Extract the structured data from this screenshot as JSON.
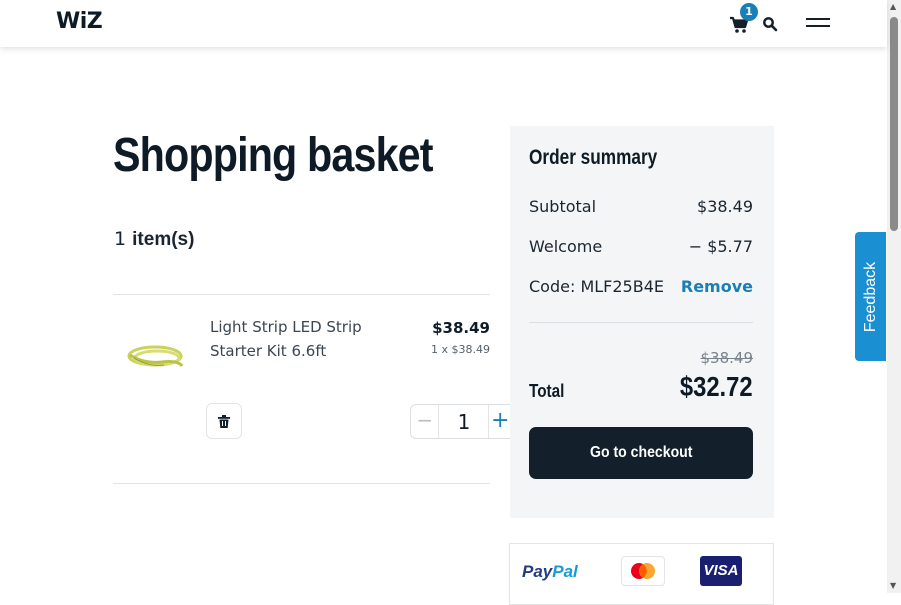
{
  "header": {
    "logo_text": "WiZ",
    "cart_count": "1",
    "icons": [
      "cart-icon",
      "search-icon",
      "menu-icon"
    ]
  },
  "basket": {
    "title": "Shopping basket",
    "item_count": "1",
    "item_count_label": "item(s)",
    "items": [
      {
        "name": "Light Strip LED Strip Starter Kit 6.6ft",
        "price": "$38.49",
        "unit_price": "1 x $38.49",
        "quantity": "1",
        "minus_label": "−",
        "plus_label": "+"
      }
    ]
  },
  "summary": {
    "title": "Order summary",
    "subtotal_label": "Subtotal",
    "subtotal_value": "$38.49",
    "discount_label": "Welcome",
    "discount_value": "− $5.77",
    "code_label": "Code: MLF25B4E",
    "remove_label": "Remove",
    "original_total": "$38.49",
    "total_label": "Total",
    "total_value": "$32.72",
    "checkout_label": "Go to checkout"
  },
  "payments": {
    "paypal_part1": "Pay",
    "paypal_part2": "Pal",
    "visa_label": "VISA",
    "methods": [
      "paypal",
      "mastercard",
      "visa"
    ]
  },
  "feedback": {
    "label": "Feedback"
  },
  "colors": {
    "accent": "#1a7fb5",
    "feedback": "#1a8fd1",
    "checkout_bg": "#13202b",
    "summary_bg": "#f4f5f6"
  }
}
